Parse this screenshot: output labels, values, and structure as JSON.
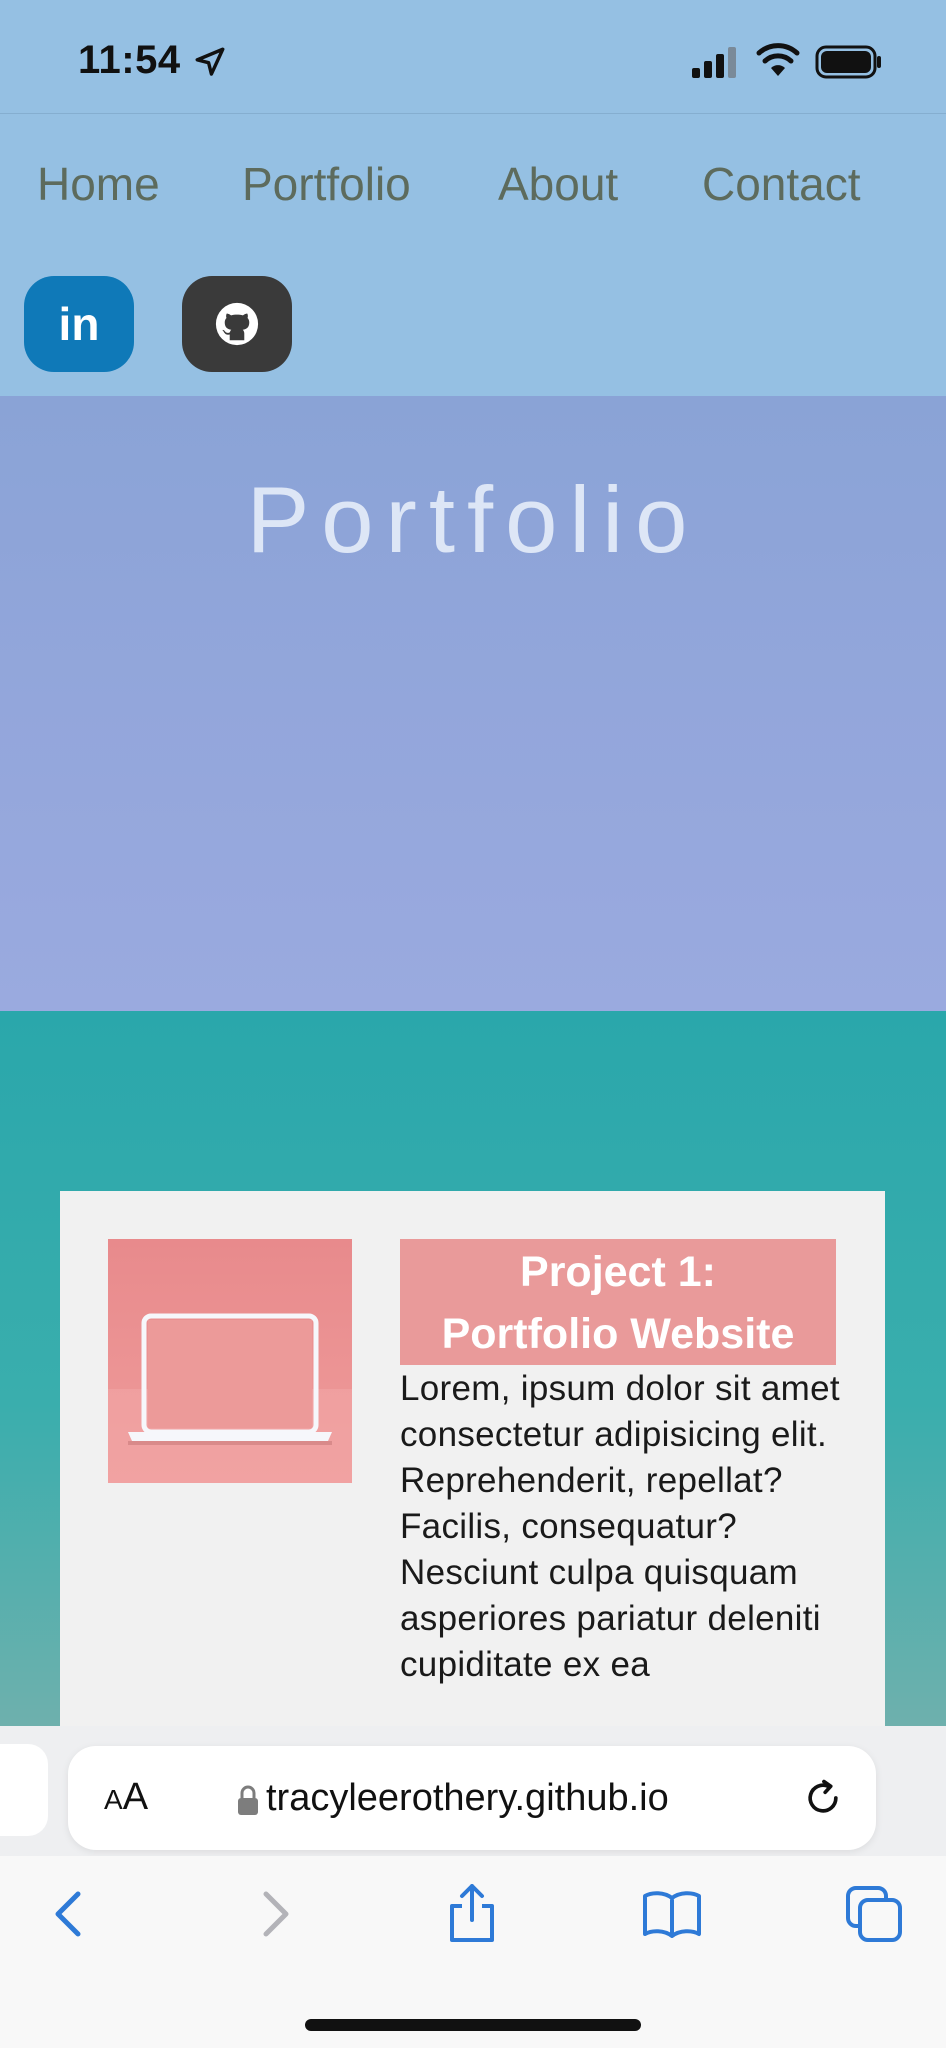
{
  "status_bar": {
    "time": "11:54",
    "icons": [
      "location-arrow-icon",
      "cellular-signal-icon",
      "wifi-icon",
      "battery-icon"
    ]
  },
  "nav": {
    "links": [
      "Home",
      "Portfolio",
      "About",
      "Contact"
    ],
    "social": [
      {
        "name": "linkedin",
        "label": "in",
        "color": "#0f79b8"
      },
      {
        "name": "github",
        "icon": "github-icon",
        "color": "#3a3a3a"
      }
    ]
  },
  "hero": {
    "title": "Portfolio"
  },
  "projects": [
    {
      "title_line1": "Project 1:",
      "title_line2": "Portfolio Website",
      "description": "Lorem, ipsum dolor sit amet consectetur adipisicing elit. Reprehenderit, repellat? Facilis, consequatur? Nesciunt culpa quisquam asperiores pariatur deleniti cupiditate ex ea",
      "thumbnail_icon": "laptop-icon"
    }
  ],
  "browser": {
    "text_size_label": "AA",
    "url": "tracyleerothery.github.io",
    "toolbar": [
      "back-icon",
      "forward-icon",
      "share-icon",
      "bookmarks-icon",
      "tabs-icon"
    ]
  },
  "colors": {
    "nav_bg": "#95c0e3",
    "hero_bg": "#93a6db",
    "teal_bg": "#2aa7ab",
    "title_box": "#e99a9a",
    "ios_blue": "#2e7ad7"
  }
}
